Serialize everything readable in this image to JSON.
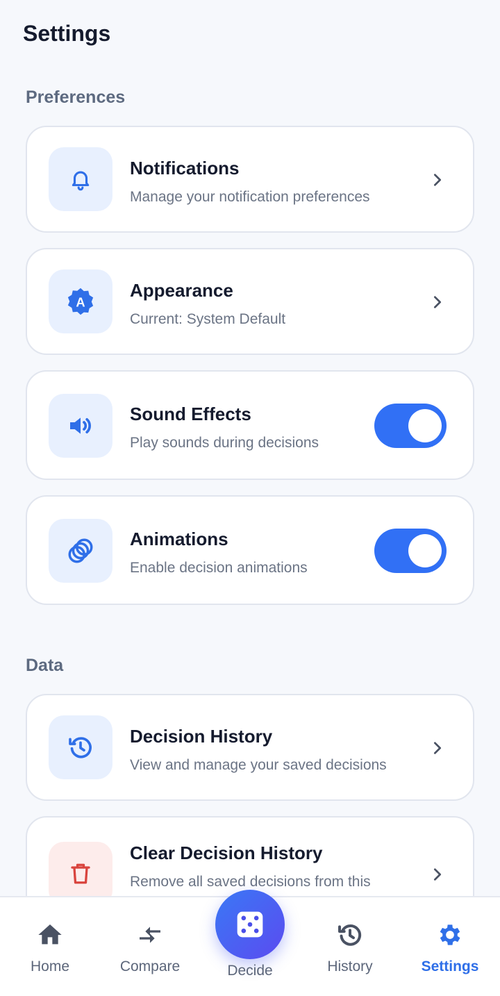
{
  "header": {
    "title": "Settings"
  },
  "sections": {
    "preferences": "Preferences",
    "data": "Data"
  },
  "items": {
    "notifications": {
      "title": "Notifications",
      "subtitle": "Manage your notification preferences",
      "icon": "bell-icon"
    },
    "appearance": {
      "title": "Appearance",
      "subtitle": "Current: System Default",
      "icon": "theme-icon"
    },
    "sound_effects": {
      "title": "Sound Effects",
      "subtitle": "Play sounds during decisions",
      "icon": "speaker-icon",
      "enabled": true
    },
    "animations": {
      "title": "Animations",
      "subtitle": "Enable decision animations",
      "icon": "animation-rings-icon",
      "enabled": true
    },
    "decision_history": {
      "title": "Decision History",
      "subtitle": "View and manage your saved decisions",
      "icon": "history-icon"
    },
    "clear_history": {
      "title": "Clear Decision History",
      "subtitle": "Remove all saved decisions from this",
      "icon": "trash-icon"
    }
  },
  "nav": {
    "home": "Home",
    "compare": "Compare",
    "decide": "Decide",
    "history": "History",
    "settings": "Settings",
    "active": "settings"
  },
  "colors": {
    "accent": "#3170f5",
    "icon_bg": "#e8f0fe",
    "danger": "#d9443e",
    "danger_bg": "#fdeceb",
    "background": "#f6f8fc"
  }
}
